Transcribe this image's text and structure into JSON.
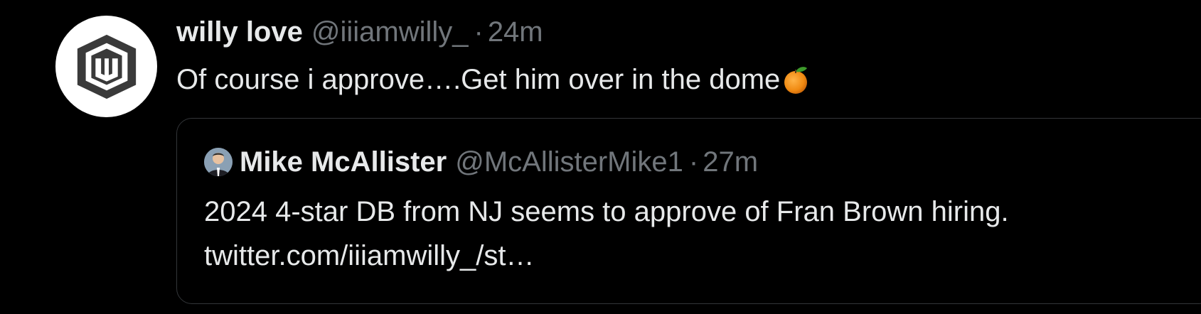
{
  "tweet": {
    "author": {
      "display_name": "willy love",
      "handle": "@iiiamwilly_",
      "avatar_icon": "w-shield-logo-icon"
    },
    "separator": "·",
    "timestamp": "24m",
    "text": "Of course i approve….Get him over in the dome",
    "emoji": "tangerine-emoji-icon"
  },
  "quoted_tweet": {
    "author": {
      "display_name": "Mike McAllister",
      "handle": "@McAllisterMike1",
      "avatar_icon": "profile-photo-icon"
    },
    "separator": "·",
    "timestamp": "27m",
    "text_line_1": "2024 4-star DB from NJ seems to approve of Fran Brown hiring.",
    "text_line_2": "twitter.com/iiiamwilly_/st…"
  },
  "colors": {
    "background": "#000000",
    "primary_text": "#e7e9ea",
    "secondary_text": "#71767b",
    "card_border": "#333639"
  }
}
